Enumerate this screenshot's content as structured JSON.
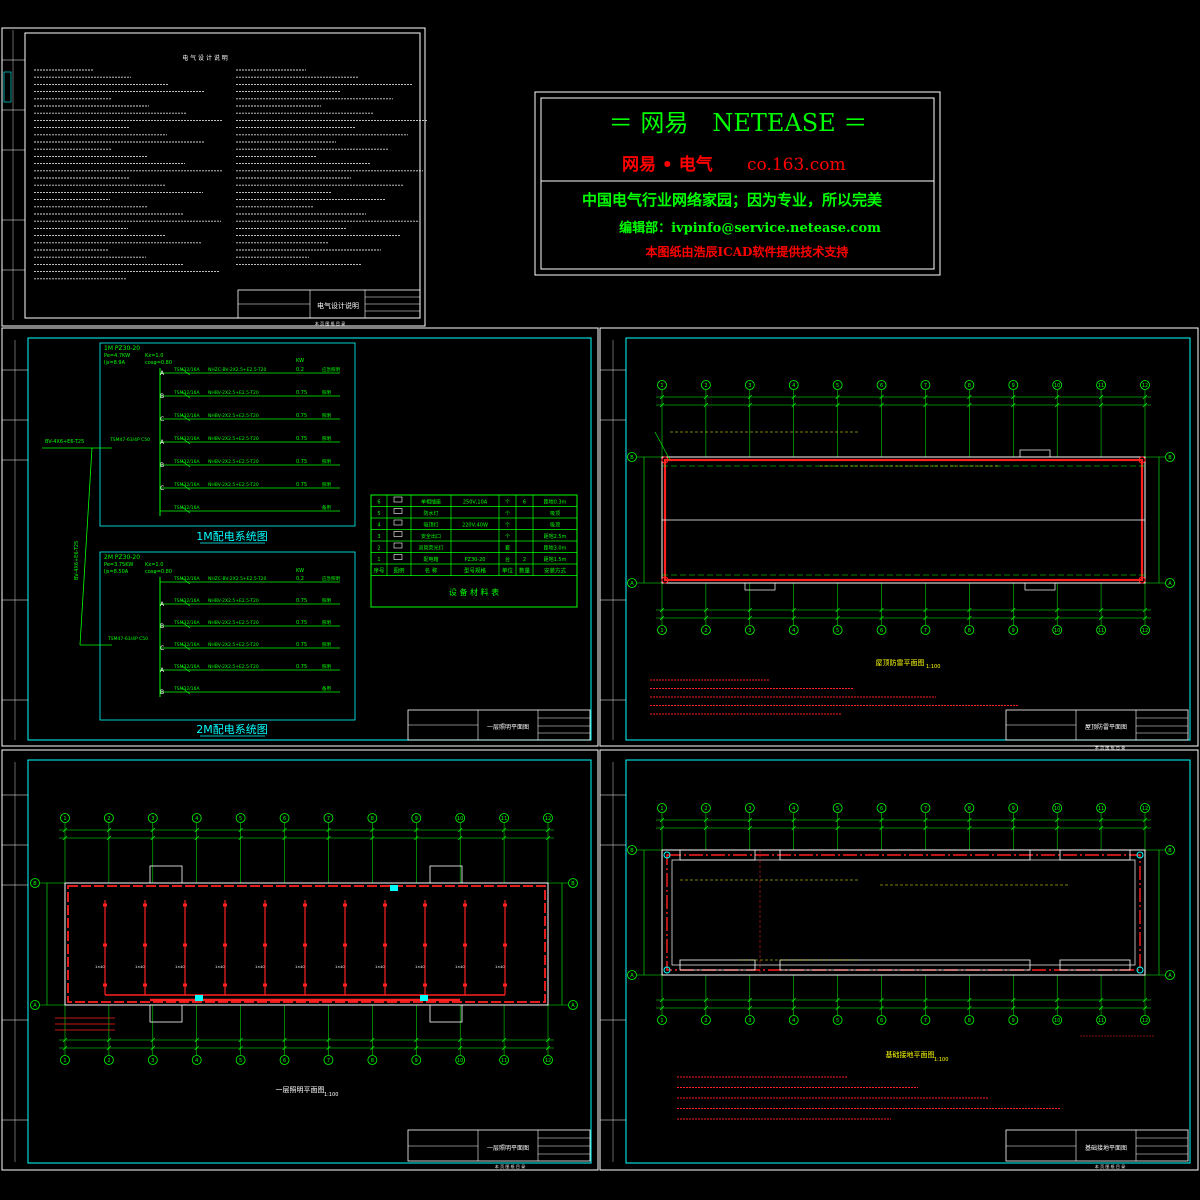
{
  "banner": {
    "line1": "＝ 网易　NETEASE ＝",
    "line2a": "网易 • 电气",
    "line2b": "co.163.com",
    "line3": "中国电气行业网络家园；因为专业，所以完美",
    "line4": "编辑部：ivpinfo@service.netease.com",
    "line5": "本图纸由浩辰ICAD软件提供技术支持"
  },
  "sheet1": {
    "title": "电 气 设 计 说 明",
    "block_title": "电气设计说明",
    "footer": "本 页 图 纸 目 录"
  },
  "sheet2": {
    "panel1_name": "1M PZ30-20",
    "panel1_params": [
      "Pe=4.7KW",
      "Kx=1.0",
      "Ijs=8.9A",
      "cosφ=0.80"
    ],
    "panel2_name": "2M PZ30-20",
    "panel2_params": [
      "Pe=3.75KW",
      "Kx=1.0",
      "Ijs=8.50A",
      "cosφ=0.80"
    ],
    "incoming_cable": "BV-4X6+E6-T25",
    "riser_cable": "BV-4X6+E6-T25",
    "main_breaker": "TSM47-63/4P C50",
    "kw_header": "KW",
    "breaker": "TSM32/16A",
    "circuits1": [
      {
        "phase": "A",
        "cable": "NHZC-BV-2X2.5+E2.5-T20",
        "kw": "0.2",
        "use": "应急照明"
      },
      {
        "phase": "B",
        "cable": "NHBV-2X2.5+E2.5-T20",
        "kw": "0.75",
        "use": "照明"
      },
      {
        "phase": "C",
        "cable": "NHBV-2X2.5+E2.5-T20",
        "kw": "0.75",
        "use": "照明"
      },
      {
        "phase": "A",
        "cable": "NHBV-2X2.5+E2.5-T20",
        "kw": "0.75",
        "use": "照明"
      },
      {
        "phase": "B",
        "cable": "NHBV-2X2.5+E2.5-T20",
        "kw": "0.75",
        "use": "照明"
      },
      {
        "phase": "C",
        "cable": "NHBV-2X2.5+E2.5-T20",
        "kw": "0.75",
        "use": "照明"
      },
      {
        "phase": "",
        "cable": "",
        "kw": "",
        "use": "备用"
      }
    ],
    "circuits2": [
      {
        "phase": "",
        "cable": "NHZC-BV-2X2.5+E2.5-T20",
        "kw": "0.2",
        "use": "应急照明"
      },
      {
        "phase": "A",
        "cable": "NHBV-2X2.5+E2.5-T20",
        "kw": "0.75",
        "use": "照明"
      },
      {
        "phase": "B",
        "cable": "NHBV-2X2.5+E2.5-T20",
        "kw": "0.75",
        "use": "照明"
      },
      {
        "phase": "C",
        "cable": "NHBV-2X2.5+E2.5-T20",
        "kw": "0.75",
        "use": "照明"
      },
      {
        "phase": "A",
        "cable": "NHBV-2X2.5+E2.5-T20",
        "kw": "0.75",
        "use": "照明"
      },
      {
        "phase": "B",
        "cable": "",
        "kw": "",
        "use": "备用"
      }
    ],
    "caption1": "1M配电系统图",
    "caption2": "2M配电系统图",
    "legend_title": "设 备 材 料 表",
    "legend_head": [
      "序号",
      "图例",
      "名 称",
      "型号规格",
      "单位",
      "数量",
      "安装方式"
    ],
    "legend_rows": [
      [
        "6",
        "",
        "单相插座",
        "250V,10A",
        "个",
        "6",
        "距地0.3m"
      ],
      [
        "5",
        "",
        "防水灯",
        "",
        "个",
        "",
        "吸顶"
      ],
      [
        "4",
        "",
        "吸顶灯",
        "220V,40W",
        "个",
        "",
        "吸顶"
      ],
      [
        "3",
        "",
        "安全出口",
        "",
        "个",
        "",
        "距地2.5m"
      ],
      [
        "2",
        "",
        "双管荧光灯",
        "",
        "套",
        "",
        "距地3.0m"
      ],
      [
        "1",
        "",
        "配电箱",
        "PZ30-20",
        "台",
        "2",
        "距地1.5m"
      ]
    ],
    "block_title": "一层照明平面图"
  },
  "sheet3": {
    "caption": "屋顶防雷平面图",
    "scale": "1:100",
    "block_title": "屋顶防雷平面图",
    "footer": "本 页 图 纸 目 录"
  },
  "sheet4": {
    "caption": "一层照明平面图",
    "scale": "1:100",
    "block_title": "一层照明平面图",
    "footer": "本 页 图 纸 目 录"
  },
  "sheet5": {
    "caption": "基础接地平面图",
    "scale": "1:100",
    "block_title": "基础接地平面图",
    "footer": "本 页 图 纸 目 录"
  },
  "axes": [
    "1",
    "2",
    "3",
    "4",
    "5",
    "6",
    "7",
    "8",
    "9",
    "10",
    "11",
    "12"
  ],
  "axes_rows": [
    "A",
    "B"
  ],
  "colors": {
    "frame": "#ffffff",
    "cyan": "#00ffff",
    "green": "#00ff00",
    "red": "#ff2020",
    "yellow": "#ffff00",
    "banner_green": "#00ff00",
    "banner_red": "#ff0000"
  }
}
